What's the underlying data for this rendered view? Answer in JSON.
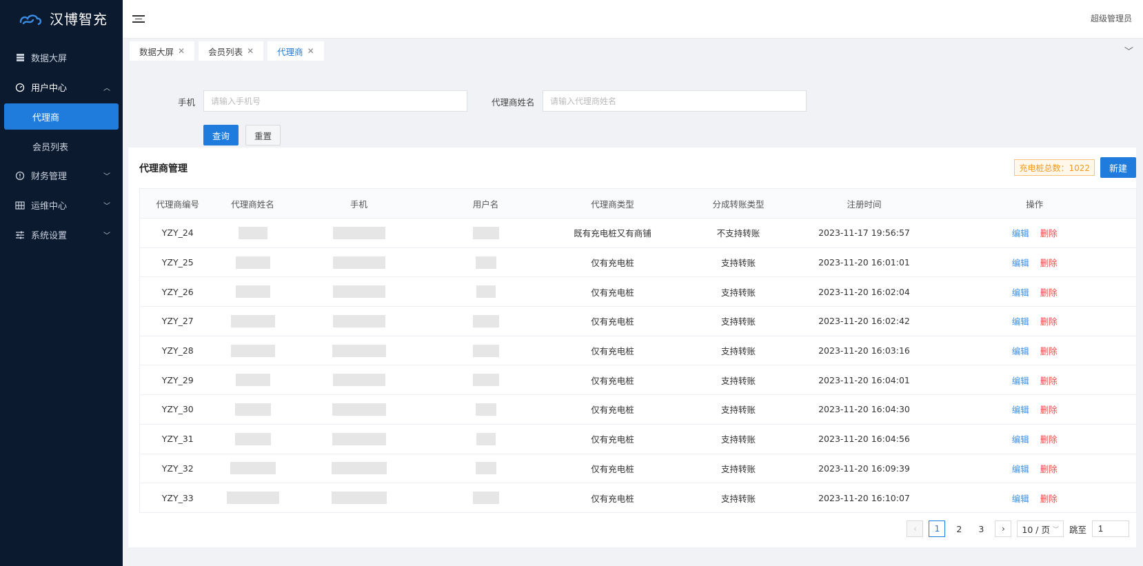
{
  "app": {
    "title": "汉博智充"
  },
  "sidebar": {
    "items": [
      {
        "label": "数据大屏",
        "icon": "server-icon"
      },
      {
        "label": "用户中心",
        "icon": "dashboard-icon",
        "expanded": true,
        "children": [
          {
            "label": "代理商",
            "active": true
          },
          {
            "label": "会员列表"
          }
        ]
      },
      {
        "label": "财务管理",
        "icon": "alert-circle-icon"
      },
      {
        "label": "运维中心",
        "icon": "grid-icon"
      },
      {
        "label": "系统设置",
        "icon": "sliders-icon"
      }
    ]
  },
  "header": {
    "user": "超级管理员"
  },
  "tabs": [
    {
      "label": "数据大屏"
    },
    {
      "label": "会员列表"
    },
    {
      "label": "代理商",
      "active": true
    }
  ],
  "search": {
    "phone_label": "手机",
    "phone_placeholder": "请输入手机号",
    "name_label": "代理商姓名",
    "name_placeholder": "请输入代理商姓名",
    "query_label": "查询",
    "reset_label": "重置"
  },
  "panel": {
    "title": "代理商管理",
    "count_text": "充电桩总数：1022",
    "new_label": "新建"
  },
  "table": {
    "columns": [
      "代理商编号",
      "代理商姓名",
      "手机",
      "用户名",
      "代理商类型",
      "分成转账类型",
      "注册时间",
      "操作"
    ],
    "rows": [
      {
        "id": "YZY_24",
        "type": "既有充电桩又有商铺",
        "transfer": "不支持转账",
        "time": "2023-11-17 19:56:57"
      },
      {
        "id": "YZY_25",
        "type": "仅有充电桩",
        "transfer": "支持转账",
        "time": "2023-11-20 16:01:01"
      },
      {
        "id": "YZY_26",
        "type": "仅有充电桩",
        "transfer": "支持转账",
        "time": "2023-11-20 16:02:04"
      },
      {
        "id": "YZY_27",
        "type": "仅有充电桩",
        "transfer": "支持转账",
        "time": "2023-11-20 16:02:42"
      },
      {
        "id": "YZY_28",
        "type": "仅有充电桩",
        "transfer": "支持转账",
        "time": "2023-11-20 16:03:16"
      },
      {
        "id": "YZY_29",
        "type": "仅有充电桩",
        "transfer": "支持转账",
        "time": "2023-11-20 16:04:01"
      },
      {
        "id": "YZY_30",
        "type": "仅有充电桩",
        "transfer": "支持转账",
        "time": "2023-11-20 16:04:30"
      },
      {
        "id": "YZY_31",
        "type": "仅有充电桩",
        "transfer": "支持转账",
        "time": "2023-11-20 16:04:56"
      },
      {
        "id": "YZY_32",
        "type": "仅有充电桩",
        "transfer": "支持转账",
        "time": "2023-11-20 16:09:39"
      },
      {
        "id": "YZY_33",
        "type": "仅有充电桩",
        "transfer": "支持转账",
        "time": "2023-11-20 16:10:07"
      }
    ],
    "edit_label": "编辑",
    "delete_label": "删除"
  },
  "pagination": {
    "pages": [
      "1",
      "2",
      "3"
    ],
    "current": "1",
    "page_size": "10 / 页",
    "jump_label": "跳至",
    "jump_value": "1"
  },
  "colors": {
    "sidebar_bg": "#0c1a30",
    "accent": "#1f7bdc",
    "danger": "#f04a4a",
    "warning": "#f29b1f"
  }
}
